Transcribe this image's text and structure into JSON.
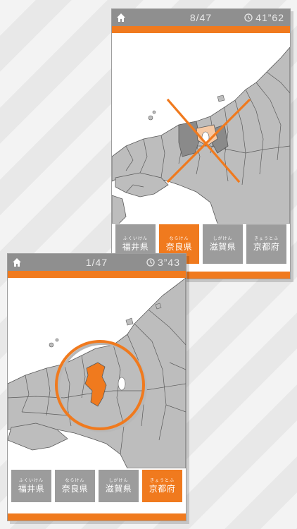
{
  "back_card": {
    "progress": "8/47",
    "timer": "41”62",
    "answers": [
      {
        "reading": "ふくいけん",
        "label": "福井県",
        "highlighted": false
      },
      {
        "reading": "ならけん",
        "label": "奈良県",
        "highlighted": true
      },
      {
        "reading": "しがけん",
        "label": "滋賀県",
        "highlighted": false
      },
      {
        "reading": "きょうとふ",
        "label": "京都府",
        "highlighted": false
      }
    ],
    "result_mark": "cross-mark"
  },
  "front_card": {
    "progress": "1/47",
    "timer": "3”43",
    "answers": [
      {
        "reading": "ふくいけん",
        "label": "福井県",
        "highlighted": false
      },
      {
        "reading": "ならけん",
        "label": "奈良県",
        "highlighted": false
      },
      {
        "reading": "しがけん",
        "label": "滋賀県",
        "highlighted": false
      },
      {
        "reading": "きょうとふ",
        "label": "京都府",
        "highlighted": true
      }
    ],
    "result_mark": "circle-mark"
  },
  "colors": {
    "accent": "#f07a1e",
    "header": "#8f8f8f",
    "button": "#9c9c9c",
    "map_land": "#bdbdbd",
    "map_region_dark": "#8a8a8a"
  },
  "icons": [
    "home-icon",
    "clock-icon"
  ]
}
